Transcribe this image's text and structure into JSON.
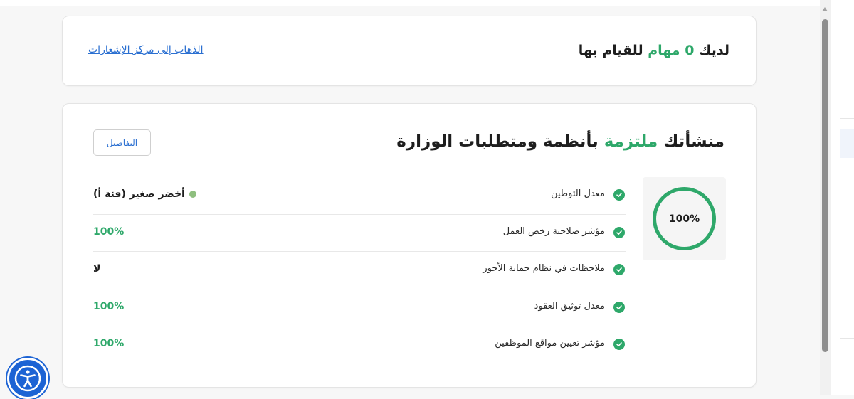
{
  "tasks_card": {
    "title_prefix": "لديك",
    "task_count": "0",
    "title_mid": "مهام",
    "title_suffix": "للقيام بها",
    "notification_link": "الذهاب إلى مركز الإشعارات"
  },
  "compliance_card": {
    "title_prefix": "منشأتك",
    "title_status": "ملتزمة",
    "title_suffix": "بأنظمة ومتطلبات الوزارة",
    "details_button": "التفاصيل",
    "overall_percent": 100,
    "overall_label": "100%",
    "metrics": [
      {
        "label": "معدل التوطين",
        "value": "أخضر صغير (فئة أ)"
      },
      {
        "label": "مؤشر صلاحية رخص العمل",
        "value": "100%"
      },
      {
        "label": "ملاحظات في نظام حماية الأجور",
        "value": "لا"
      },
      {
        "label": "معدل توثيق العقود",
        "value": "100%"
      },
      {
        "label": "مؤشر تعيين مواقع الموظفين",
        "value": "100%"
      }
    ]
  },
  "colors": {
    "accent_green": "#2ea86a",
    "link_blue": "#2a6fd1",
    "accessibility_blue": "#1c63d4",
    "nitaqat_green_dot": "#8fbf7f"
  },
  "icons": {
    "check": "check-circle-icon",
    "accessibility": "accessibility-icon",
    "scroll_up": "scroll-up-arrow-icon"
  }
}
